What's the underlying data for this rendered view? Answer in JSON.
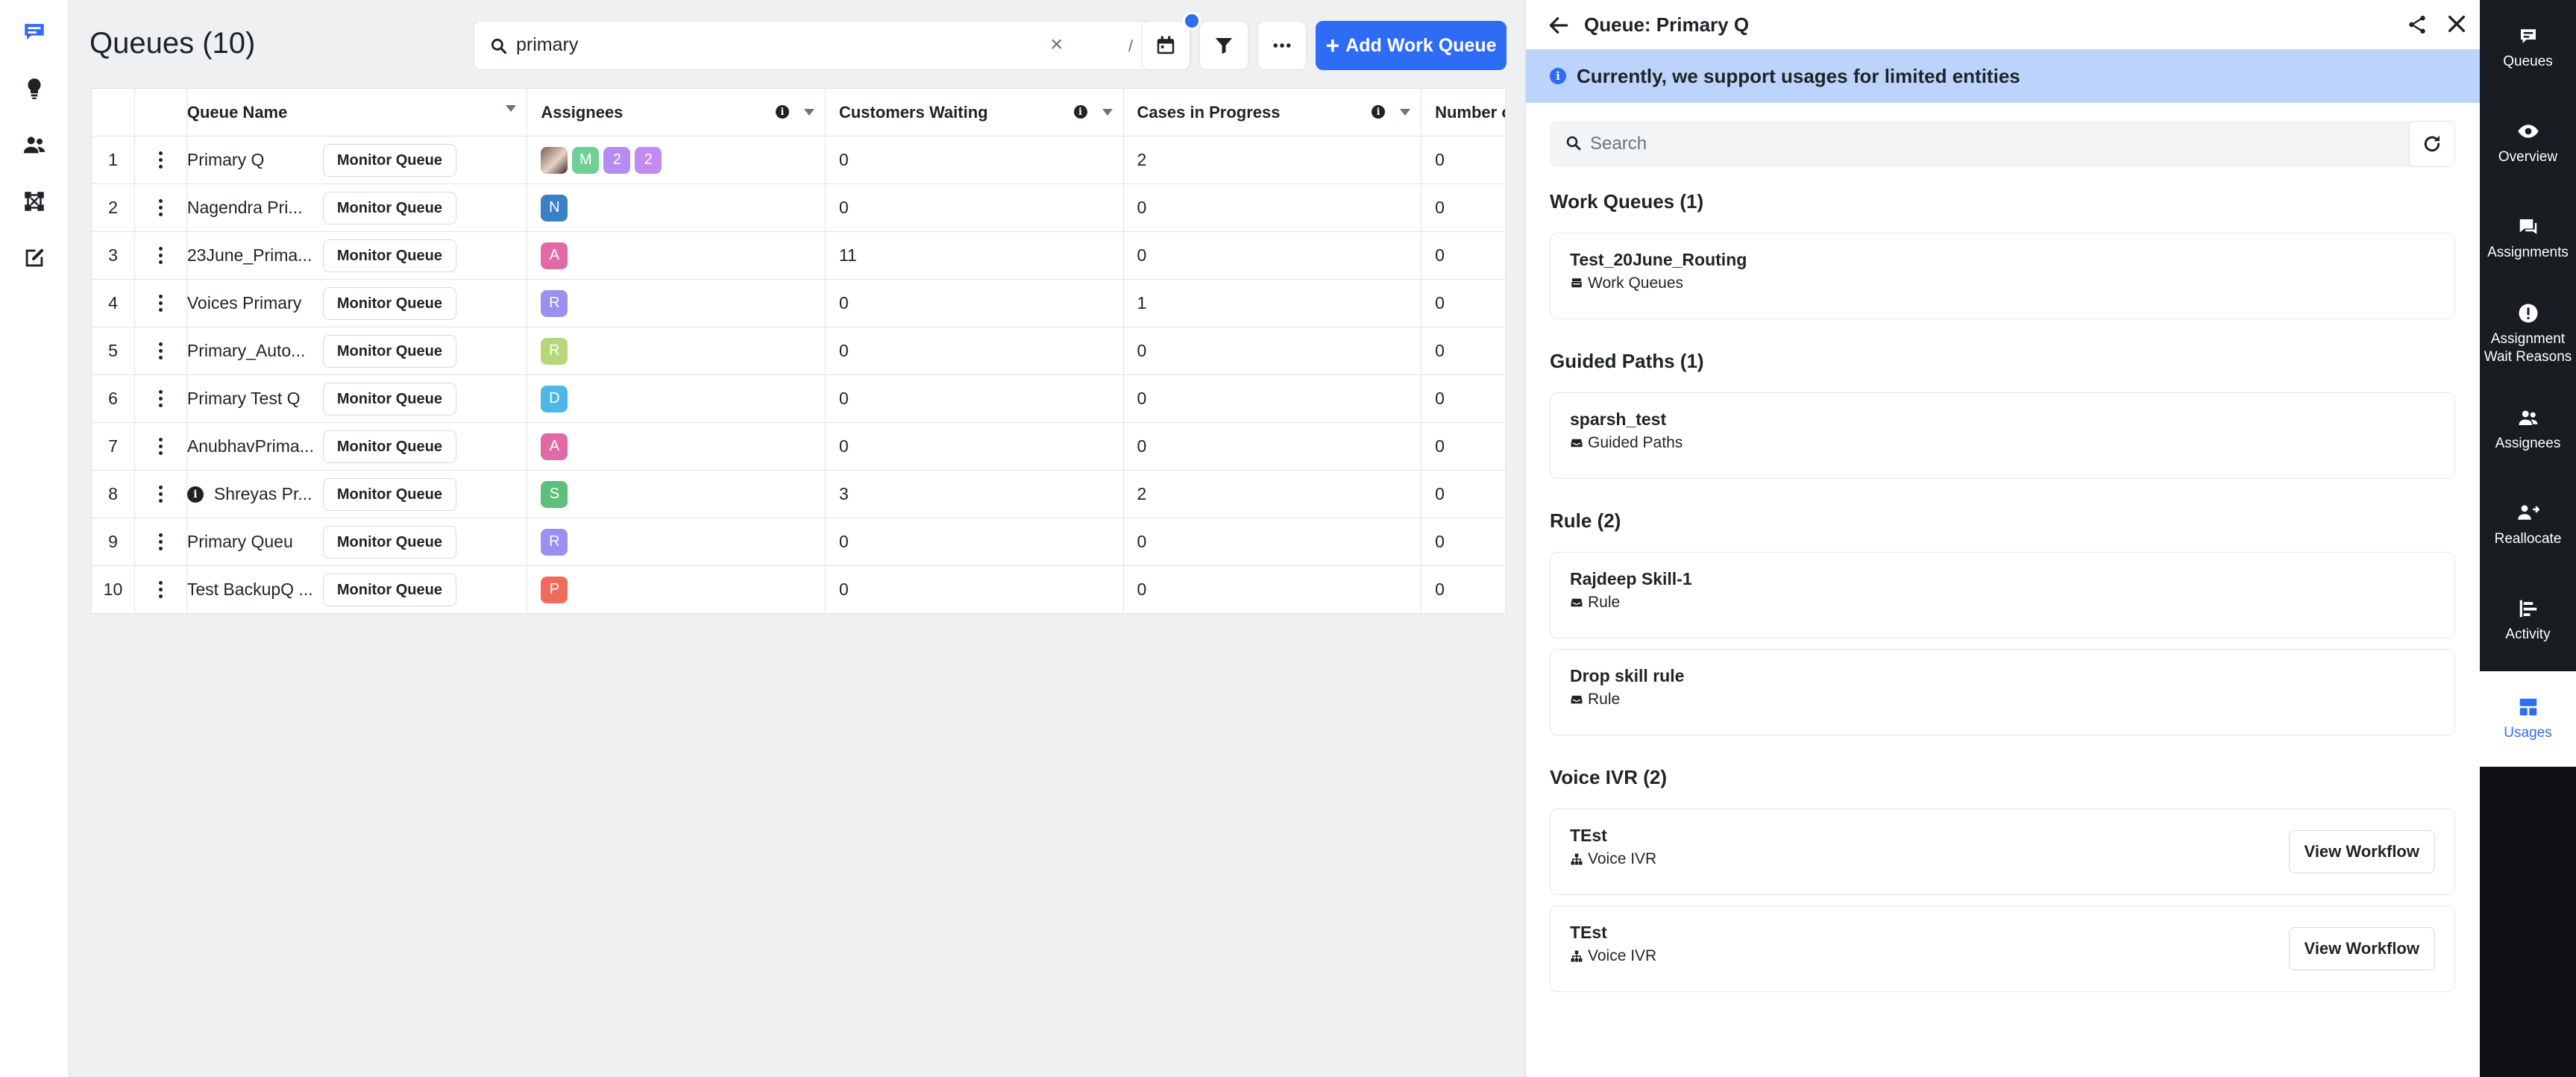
{
  "main": {
    "title": "Queues (10)",
    "search": {
      "value": "primary",
      "clear_glyph": "×",
      "shortcut": "/"
    },
    "add_button_label": "Add Work Queue",
    "add_button_icon": "+",
    "table": {
      "headers": [
        "Queue Name",
        "Assignees",
        "Customers Waiting",
        "Cases in Progress",
        "Number of Agen"
      ],
      "rows": [
        {
          "idx": "1",
          "name": "Primary Q",
          "monitor": "Monitor Queue",
          "assignees": [
            {
              "type": "photo",
              "label": ""
            },
            {
              "type": "letter",
              "label": "M",
              "color": "#6fcf97"
            },
            {
              "type": "letter",
              "label": "2",
              "color": "#b58cf3"
            },
            {
              "type": "letter",
              "label": "2",
              "color": "#c18bf0"
            }
          ],
          "waiting": "0",
          "progress": "2",
          "agents": "0"
        },
        {
          "idx": "2",
          "name": "Nagendra Pri...",
          "monitor": "Monitor Queue",
          "assignees": [
            {
              "type": "letter",
              "label": "N",
              "color": "#3b7fc4"
            }
          ],
          "waiting": "0",
          "progress": "0",
          "agents": "0"
        },
        {
          "idx": "3",
          "name": "23June_Prima...",
          "monitor": "Monitor Queue",
          "assignees": [
            {
              "type": "letter",
              "label": "A",
              "color": "#e06aa5"
            }
          ],
          "waiting": "11",
          "progress": "0",
          "agents": "0"
        },
        {
          "idx": "4",
          "name": "Voices Primary",
          "monitor": "Monitor Queue",
          "assignees": [
            {
              "type": "letter",
              "label": "R",
              "color": "#9b8ff0"
            }
          ],
          "waiting": "0",
          "progress": "1",
          "agents": "0"
        },
        {
          "idx": "5",
          "name": "Primary_Auto...",
          "monitor": "Monitor Queue",
          "assignees": [
            {
              "type": "letter",
              "label": "R",
              "color": "#b5d77a"
            }
          ],
          "waiting": "0",
          "progress": "0",
          "agents": "0"
        },
        {
          "idx": "6",
          "name": "Primary Test Q",
          "monitor": "Monitor Queue",
          "assignees": [
            {
              "type": "letter",
              "label": "D",
              "color": "#4fb7e8"
            }
          ],
          "waiting": "0",
          "progress": "0",
          "agents": "0"
        },
        {
          "idx": "7",
          "name": "AnubhavPrima...",
          "monitor": "Monitor Queue",
          "assignees": [
            {
              "type": "letter",
              "label": "A",
              "color": "#e06aa5"
            }
          ],
          "waiting": "0",
          "progress": "0",
          "agents": "0"
        },
        {
          "idx": "8",
          "name": "Shreyas Pr...",
          "info": true,
          "monitor": "Monitor Queue",
          "assignees": [
            {
              "type": "letter",
              "label": "S",
              "color": "#5cbf7a"
            }
          ],
          "waiting": "3",
          "progress": "2",
          "agents": "0"
        },
        {
          "idx": "9",
          "name": "Primary Queu",
          "monitor": "Monitor Queue",
          "assignees": [
            {
              "type": "letter",
              "label": "R",
              "color": "#9b8ff0"
            }
          ],
          "waiting": "0",
          "progress": "0",
          "agents": "0"
        },
        {
          "idx": "10",
          "name": "Test BackupQ ...",
          "monitor": "Monitor Queue",
          "assignees": [
            {
              "type": "letter",
              "label": "P",
              "color": "#ef6b5c"
            }
          ],
          "waiting": "0",
          "progress": "0",
          "agents": "0"
        }
      ]
    }
  },
  "panel": {
    "title": "Queue: Primary Q",
    "banner": "Currently, we support usages for limited entities",
    "search_placeholder": "Search",
    "sections": [
      {
        "title": "Work Queues (1)",
        "items": [
          {
            "title": "Test_20June_Routing",
            "sub": "Work Queues",
            "icon": "work-queue-icon"
          }
        ]
      },
      {
        "title": "Guided Paths (1)",
        "items": [
          {
            "title": "sparsh_test",
            "sub": "Guided Paths",
            "icon": "inbox-icon"
          }
        ]
      },
      {
        "title": "Rule (2)",
        "items": [
          {
            "title": "Rajdeep Skill-1",
            "sub": "Rule",
            "icon": "inbox-icon"
          },
          {
            "title": "Drop skill rule",
            "sub": "Rule",
            "icon": "inbox-icon"
          }
        ]
      },
      {
        "title": "Voice IVR (2)",
        "items": [
          {
            "title": "TEst",
            "sub": "Voice IVR",
            "icon": "hierarchy-icon",
            "action": "View Workflow"
          },
          {
            "title": "TEst",
            "sub": "Voice IVR",
            "icon": "hierarchy-icon",
            "action": "View Workflow"
          }
        ]
      }
    ]
  },
  "rail": {
    "items": [
      {
        "label": "Queues",
        "icon": "queues-icon"
      },
      {
        "label": "Overview",
        "icon": "eye-icon"
      },
      {
        "label": "Assignments",
        "icon": "chat-icon"
      },
      {
        "label": "Assignment Wait Reasons",
        "icon": "alert-icon"
      },
      {
        "label": "Assignees",
        "icon": "people-icon"
      },
      {
        "label": "Reallocate",
        "icon": "reallocate-icon"
      },
      {
        "label": "Activity",
        "icon": "activity-icon"
      },
      {
        "label": "Usages",
        "icon": "usages-icon",
        "active": true
      }
    ]
  },
  "colors": {
    "accent": "#2e6cf6",
    "banner": "#bcd4fb",
    "rail": "#191c20"
  }
}
